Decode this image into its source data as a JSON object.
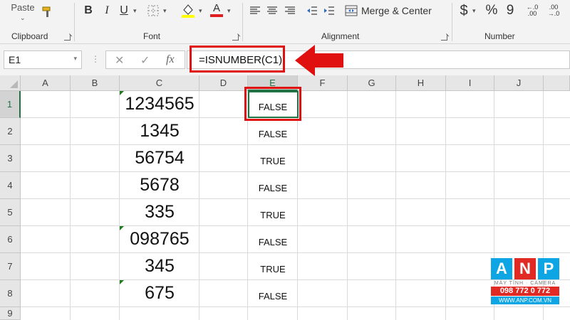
{
  "ribbon": {
    "clipboard": {
      "paste_label": "Paste",
      "group_label": "Clipboard"
    },
    "font": {
      "group_label": "Font",
      "bold": "B",
      "italic": "I",
      "underline": "U",
      "font_color_letter": "A"
    },
    "alignment": {
      "group_label": "Alignment",
      "merge_label": "Merge & Center"
    },
    "number": {
      "group_label": "Number",
      "currency": "$",
      "percent": "%",
      "comma": "9",
      "increase_decimal": "←.0 .00",
      "decrease_decimal": ".00 →.0"
    }
  },
  "formula_bar": {
    "name_box": "E1",
    "cancel": "✕",
    "enter": "✓",
    "fx": "fx",
    "formula": "=ISNUMBER(C1)"
  },
  "sheet": {
    "columns": [
      "A",
      "B",
      "C",
      "D",
      "E",
      "F",
      "G",
      "H",
      "I",
      "J"
    ],
    "active_column": "E",
    "rows": [
      "1",
      "2",
      "3",
      "4",
      "5",
      "6",
      "7",
      "8",
      "9"
    ],
    "active_row": "1",
    "column_c": [
      "1234565",
      "1345",
      "56754",
      "5678",
      "335",
      "098765",
      "345",
      "675"
    ],
    "column_e": [
      "FALSE",
      "FALSE",
      "TRUE",
      "FALSE",
      "TRUE",
      "FALSE",
      "TRUE",
      "FALSE"
    ]
  },
  "logo": {
    "letters": [
      "A",
      "N",
      "P"
    ],
    "letter_colors": [
      "#0ea5e4",
      "#e22a25",
      "#0ea5e4"
    ],
    "tagline": "MÁY TÍNH · CAMERA",
    "phone": "098 772 0 772",
    "website": "WWW.ANP.COM.VN"
  },
  "colors": {
    "excel_green": "#217346",
    "highlight_red": "#e01010"
  }
}
